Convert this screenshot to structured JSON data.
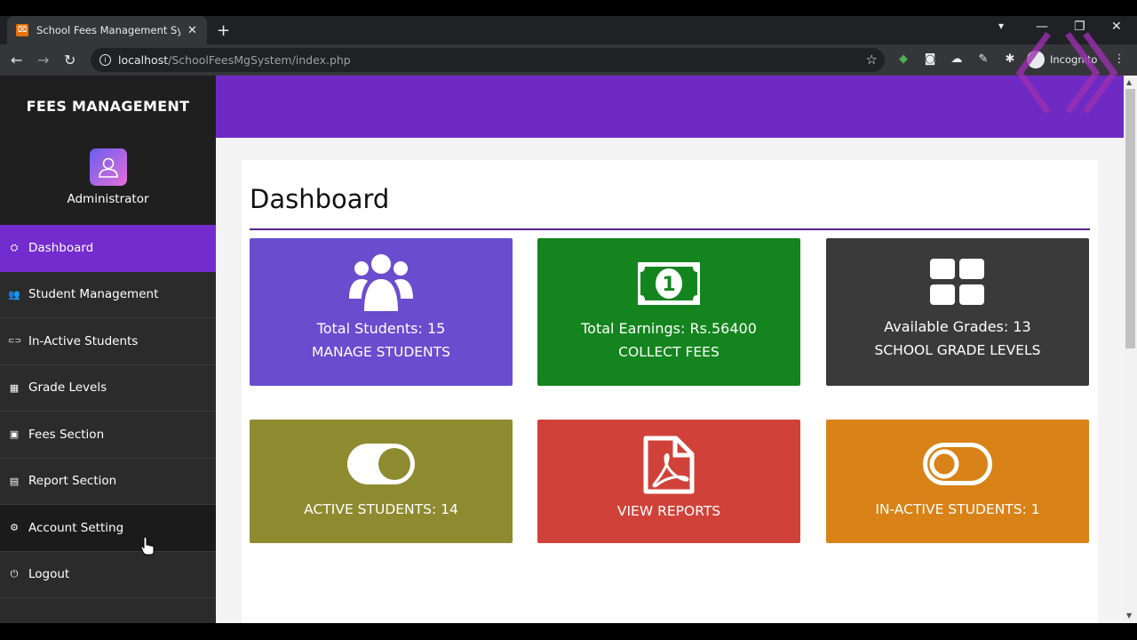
{
  "browser": {
    "tab_title": "School Fees Management System",
    "tab_favicon": "xampp-icon",
    "url_host": "localhost",
    "url_path": "/SchoolFeesMgSystem/index.php",
    "profile_label": "Incognito"
  },
  "sidebar": {
    "brand": "FEES MANAGEMENT",
    "user_name": "Administrator",
    "items": [
      {
        "label": "Dashboard",
        "icon": "dashboard-icon",
        "glyph": "⛭"
      },
      {
        "label": "Student Management",
        "icon": "users-icon",
        "glyph": "👥"
      },
      {
        "label": "In-Active Students",
        "icon": "toggle-off-icon",
        "glyph": "⊂⊃"
      },
      {
        "label": "Grade Levels",
        "icon": "grid-icon",
        "glyph": "▦"
      },
      {
        "label": "Fees Section",
        "icon": "money-icon",
        "glyph": "▣"
      },
      {
        "label": "Report Section",
        "icon": "file-pdf-icon",
        "glyph": "▤"
      },
      {
        "label": "Account Setting",
        "icon": "cogs-icon",
        "glyph": "⚙"
      },
      {
        "label": "Logout",
        "icon": "power-icon",
        "glyph": "⏻"
      }
    ]
  },
  "main": {
    "title": "Dashboard",
    "tiles": [
      {
        "line1": "Total Students: 15",
        "line2": "MANAGE STUDENTS",
        "icon": "users-icon",
        "color": "#6a4ccf"
      },
      {
        "line1": "Total Earnings: Rs.56400",
        "line2": "COLLECT FEES",
        "icon": "money-bill-icon",
        "color": "#14851e"
      },
      {
        "line1": "Available Grades: 13",
        "line2": "SCHOOL GRADE LEVELS",
        "icon": "grid-icon",
        "color": "#3a3a3a"
      },
      {
        "label": "ACTIVE STUDENTS: 14",
        "icon": "toggle-on-icon",
        "color": "#8e8a2f"
      },
      {
        "label": "VIEW REPORTS",
        "icon": "file-pdf-icon",
        "color": "#d04239"
      },
      {
        "label": "IN-ACTIVE STUDENTS: 1",
        "icon": "toggle-off-icon",
        "color": "#d98218"
      }
    ]
  },
  "colors": {
    "accent": "#742ccf",
    "topbar": "#6f2ac4",
    "sidebar": "#2b2b2b"
  }
}
